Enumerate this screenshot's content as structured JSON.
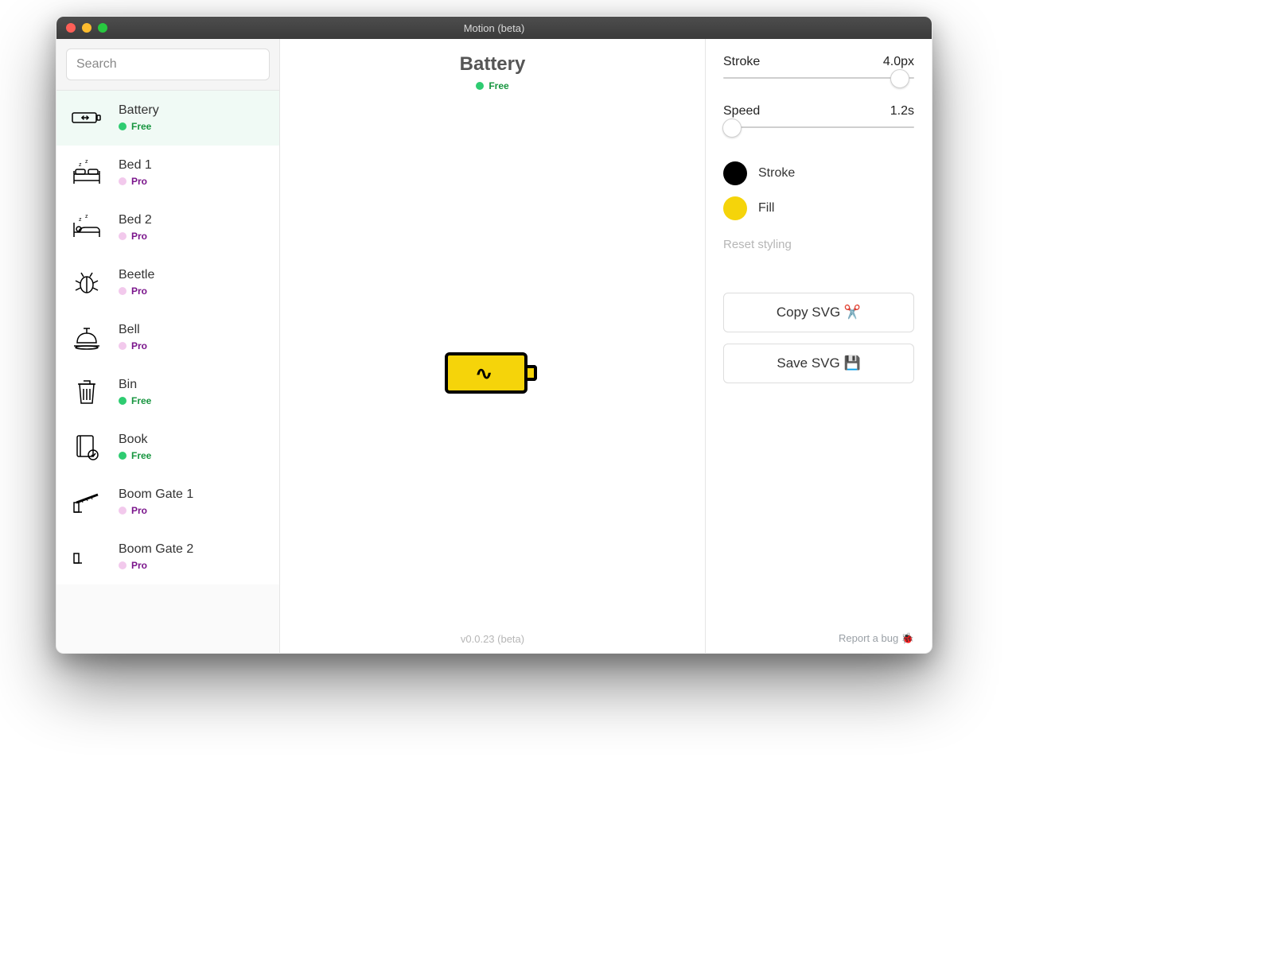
{
  "window": {
    "title": "Motion (beta)"
  },
  "search": {
    "placeholder": "Search"
  },
  "sidebar": {
    "items": [
      {
        "name": "Battery",
        "tier": "Free",
        "selected": true,
        "icon": "battery"
      },
      {
        "name": "Bed 1",
        "tier": "Pro",
        "selected": false,
        "icon": "bed1"
      },
      {
        "name": "Bed 2",
        "tier": "Pro",
        "selected": false,
        "icon": "bed2"
      },
      {
        "name": "Beetle",
        "tier": "Pro",
        "selected": false,
        "icon": "beetle"
      },
      {
        "name": "Bell",
        "tier": "Pro",
        "selected": false,
        "icon": "bell"
      },
      {
        "name": "Bin",
        "tier": "Free",
        "selected": false,
        "icon": "bin"
      },
      {
        "name": "Book",
        "tier": "Free",
        "selected": false,
        "icon": "book"
      },
      {
        "name": "Boom Gate 1",
        "tier": "Pro",
        "selected": false,
        "icon": "boom1"
      },
      {
        "name": "Boom Gate 2",
        "tier": "Pro",
        "selected": false,
        "icon": "boom2"
      }
    ]
  },
  "main": {
    "title": "Battery",
    "tier": "Free",
    "version": "v0.0.23 (beta)"
  },
  "panel": {
    "stroke_label": "Stroke",
    "stroke_value": "4.0px",
    "stroke_slider_pct": 92,
    "speed_label": "Speed",
    "speed_value": "1.2s",
    "speed_slider_pct": 4,
    "color_stroke_label": "Stroke",
    "color_stroke_hex": "#000000",
    "color_fill_label": "Fill",
    "color_fill_hex": "#f5d40a",
    "reset_label": "Reset styling",
    "copy_label": "Copy SVG ✂️",
    "save_label": "Save SVG 💾",
    "report_label": "Report a bug 🐞"
  }
}
